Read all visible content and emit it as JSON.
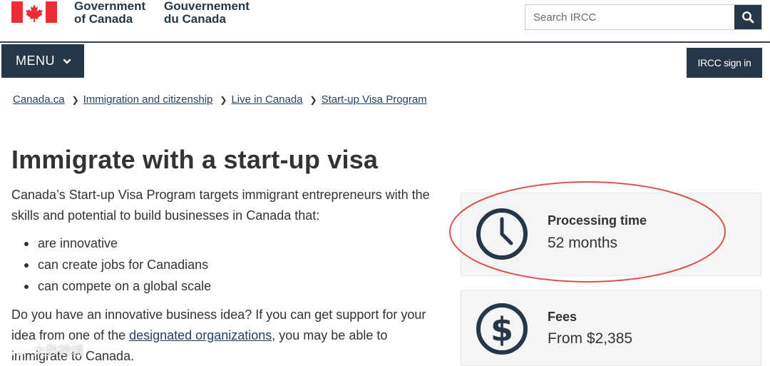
{
  "header": {
    "signature_en_line1": "Government",
    "signature_en_line2": "of Canada",
    "signature_fr_line1": "Gouvernement",
    "signature_fr_line2": "du Canada",
    "search_placeholder": "Search IRCC",
    "search_icon": "search-icon",
    "brand_color": "#26374a",
    "flag_color": "#eb2d37"
  },
  "nav": {
    "menu_label": "MENU",
    "menu_icon": "chevron-down-icon",
    "signin_label": "IRCC sign in"
  },
  "breadcrumb": [
    "Canada.ca",
    "Immigration and citizenship",
    "Live in Canada",
    "Start-up Visa Program"
  ],
  "main": {
    "title": "Immigrate with a start-up visa",
    "intro": "Canada’s Start-up Visa Program targets immigrant entrepreneurs with the skills and potential to build businesses in Canada that:",
    "bullets": [
      "are innovative",
      "can create jobs for Canadians",
      "can compete on a global scale"
    ],
    "para_before_link": "Do you have an innovative business idea? If you can get support for your idea from one of the ",
    "para_link": "designated organizations",
    "para_after_link": ", you may be able to immigrate to Canada."
  },
  "cards": {
    "processing": {
      "label": "Processing time",
      "value": "52 months",
      "icon": "clock-icon"
    },
    "fees": {
      "label": "Fees",
      "value": "From $2,385",
      "icon": "dollar-icon"
    }
  },
  "annotation": {
    "highlight_color": "#d9534f"
  },
  "watermark": {
    "text": "大数跨境"
  }
}
